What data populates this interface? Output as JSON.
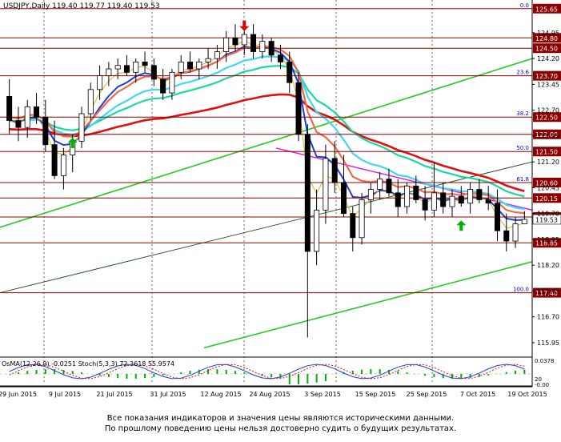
{
  "header": {
    "title": "USDJPY,Daily  119.40 119.77 119.40 119.53"
  },
  "oscillator": {
    "label": "OsMA(12,26,9) -0.0251  Stoch(5,3,3) 72.3618 55.9574",
    "scale_top": "0.0378",
    "scale_mid": "20",
    "scale_bot": "-0.00"
  },
  "disclaimer": {
    "line1": "Все показания индикаторов и значения цены являются историческими данными.",
    "line2": "По прошлому поведению цены нельзя достоверно судить о будущих результатах."
  },
  "colors": {
    "background": "#ffffff",
    "axis": "#000000",
    "candle": "#000000",
    "level_line": "#8b0000",
    "fib_text": "#0000cd",
    "right_label_bg": "#8b0000",
    "up_arrow": "#00b000",
    "down_arrow": "#e00000",
    "ema_blue": "#1c3fd8",
    "ema_cyan": "#3fd8f0",
    "ema_teal": "#1ed6a0",
    "ema_red": "#e01010",
    "ema_orange": "#f06a4a",
    "ema_yellow": "#e0b020",
    "trend_green": "#22cc22",
    "trend_magenta": "#e020e0"
  },
  "chart_data": {
    "type": "candlestick",
    "symbol": "USDJPY",
    "timeframe": "Daily",
    "ohlc_header": {
      "open": 119.4,
      "high": 119.77,
      "low": 119.4,
      "close": 119.53
    },
    "ylim": [
      115.6,
      125.9
    ],
    "y_ticks": [
      "124.95",
      "124.20",
      "123.45",
      "122.70",
      "121.95",
      "121.20",
      "120.45",
      "119.70",
      "118.95",
      "118.20",
      "117.45",
      "116.70",
      "115.95"
    ],
    "x_ticks": [
      "29 Jun 2015",
      "9 Jul 2015",
      "21 Jul 2015",
      "31 Jul 2015",
      "12 Aug 2015",
      "24 Aug 2015",
      "3 Sep 2015",
      "15 Sep 2015",
      "25 Sep 2015",
      "7 Oct 2015",
      "19 Oct 2015"
    ],
    "horizontal_levels": [
      {
        "price": 125.65,
        "label": "125.65",
        "fib": "0.0"
      },
      {
        "price": 124.8,
        "label": "124.80",
        "fib": ""
      },
      {
        "price": 124.5,
        "label": "124.50",
        "fib": ""
      },
      {
        "price": 123.7,
        "label": "123.70",
        "fib": "23.6"
      },
      {
        "price": 122.5,
        "label": "122.50",
        "fib": "38.2"
      },
      {
        "price": 122.0,
        "label": "122.00",
        "fib": ""
      },
      {
        "price": 121.5,
        "label": "121.50",
        "fib": "50.0"
      },
      {
        "price": 120.6,
        "label": "120.60",
        "fib": "61.8"
      },
      {
        "price": 120.15,
        "label": "120.15",
        "fib": ""
      },
      {
        "price": 119.6,
        "label": "119.60",
        "fib": ""
      },
      {
        "price": 118.85,
        "label": "118.85",
        "fib": ""
      },
      {
        "price": 117.4,
        "label": "117.40",
        "fib": "100.0"
      }
    ],
    "current_price": {
      "value": 119.53,
      "label": "119.53"
    },
    "candles": [
      {
        "o": 123.1,
        "h": 123.6,
        "l": 122.0,
        "c": 122.4
      },
      {
        "o": 122.4,
        "h": 122.8,
        "l": 121.8,
        "c": 122.2
      },
      {
        "o": 122.2,
        "h": 123.0,
        "l": 121.9,
        "c": 122.8
      },
      {
        "o": 122.8,
        "h": 123.2,
        "l": 122.3,
        "c": 122.5
      },
      {
        "o": 122.5,
        "h": 123.0,
        "l": 121.5,
        "c": 121.7
      },
      {
        "o": 121.7,
        "h": 122.4,
        "l": 120.7,
        "c": 120.8
      },
      {
        "o": 120.8,
        "h": 121.6,
        "l": 120.4,
        "c": 121.4
      },
      {
        "o": 121.4,
        "h": 122.0,
        "l": 120.9,
        "c": 121.8
      },
      {
        "o": 121.8,
        "h": 122.8,
        "l": 121.6,
        "c": 122.6
      },
      {
        "o": 122.6,
        "h": 123.5,
        "l": 122.4,
        "c": 123.3
      },
      {
        "o": 123.3,
        "h": 124.0,
        "l": 123.0,
        "c": 123.7
      },
      {
        "o": 123.7,
        "h": 124.1,
        "l": 123.4,
        "c": 123.9
      },
      {
        "o": 123.9,
        "h": 124.2,
        "l": 123.6,
        "c": 124.0
      },
      {
        "o": 124.0,
        "h": 124.3,
        "l": 123.7,
        "c": 123.8
      },
      {
        "o": 123.8,
        "h": 124.2,
        "l": 123.5,
        "c": 124.1
      },
      {
        "o": 124.1,
        "h": 124.4,
        "l": 123.8,
        "c": 124.0
      },
      {
        "o": 124.0,
        "h": 124.2,
        "l": 123.4,
        "c": 123.6
      },
      {
        "o": 123.6,
        "h": 123.9,
        "l": 123.0,
        "c": 123.2
      },
      {
        "o": 123.2,
        "h": 123.9,
        "l": 123.0,
        "c": 123.8
      },
      {
        "o": 123.8,
        "h": 124.3,
        "l": 123.6,
        "c": 124.1
      },
      {
        "o": 124.1,
        "h": 124.4,
        "l": 123.8,
        "c": 123.9
      },
      {
        "o": 123.9,
        "h": 124.2,
        "l": 123.6,
        "c": 124.1
      },
      {
        "o": 124.1,
        "h": 124.5,
        "l": 123.9,
        "c": 124.2
      },
      {
        "o": 124.2,
        "h": 124.6,
        "l": 123.9,
        "c": 124.4
      },
      {
        "o": 124.4,
        "h": 125.0,
        "l": 124.1,
        "c": 124.8
      },
      {
        "o": 124.8,
        "h": 125.2,
        "l": 124.4,
        "c": 124.6
      },
      {
        "o": 124.6,
        "h": 125.3,
        "l": 124.3,
        "c": 124.9
      },
      {
        "o": 124.9,
        "h": 125.2,
        "l": 124.2,
        "c": 124.4
      },
      {
        "o": 124.4,
        "h": 124.9,
        "l": 124.2,
        "c": 124.7
      },
      {
        "o": 124.7,
        "h": 124.8,
        "l": 124.1,
        "c": 124.3
      },
      {
        "o": 124.3,
        "h": 124.6,
        "l": 123.9,
        "c": 124.1
      },
      {
        "o": 124.1,
        "h": 124.4,
        "l": 123.2,
        "c": 123.5
      },
      {
        "o": 123.5,
        "h": 123.8,
        "l": 121.8,
        "c": 122.0
      },
      {
        "o": 122.0,
        "h": 122.3,
        "l": 116.1,
        "c": 118.6
      },
      {
        "o": 118.6,
        "h": 120.4,
        "l": 118.2,
        "c": 119.8
      },
      {
        "o": 119.8,
        "h": 121.7,
        "l": 119.4,
        "c": 121.3
      },
      {
        "o": 121.3,
        "h": 121.8,
        "l": 120.3,
        "c": 120.6
      },
      {
        "o": 120.6,
        "h": 121.4,
        "l": 119.6,
        "c": 119.7
      },
      {
        "o": 119.7,
        "h": 119.9,
        "l": 118.6,
        "c": 119.0
      },
      {
        "o": 119.0,
        "h": 120.3,
        "l": 118.8,
        "c": 120.1
      },
      {
        "o": 120.1,
        "h": 120.6,
        "l": 119.7,
        "c": 120.4
      },
      {
        "o": 120.4,
        "h": 120.9,
        "l": 120.1,
        "c": 120.7
      },
      {
        "o": 120.7,
        "h": 121.0,
        "l": 120.2,
        "c": 120.3
      },
      {
        "o": 120.3,
        "h": 120.7,
        "l": 119.6,
        "c": 119.9
      },
      {
        "o": 119.9,
        "h": 120.6,
        "l": 119.7,
        "c": 120.5
      },
      {
        "o": 120.5,
        "h": 120.8,
        "l": 120.0,
        "c": 120.1
      },
      {
        "o": 120.1,
        "h": 120.5,
        "l": 119.5,
        "c": 119.8
      },
      {
        "o": 119.8,
        "h": 121.2,
        "l": 119.6,
        "c": 120.3
      },
      {
        "o": 120.3,
        "h": 120.6,
        "l": 119.7,
        "c": 119.9
      },
      {
        "o": 119.9,
        "h": 120.4,
        "l": 119.6,
        "c": 120.2
      },
      {
        "o": 120.2,
        "h": 120.5,
        "l": 119.9,
        "c": 120.0
      },
      {
        "o": 120.0,
        "h": 120.6,
        "l": 119.7,
        "c": 120.4
      },
      {
        "o": 120.4,
        "h": 120.7,
        "l": 120.0,
        "c": 120.1
      },
      {
        "o": 120.1,
        "h": 120.5,
        "l": 119.8,
        "c": 120.0
      },
      {
        "o": 120.0,
        "h": 120.4,
        "l": 118.9,
        "c": 119.2
      },
      {
        "o": 119.2,
        "h": 119.7,
        "l": 118.6,
        "c": 118.9
      },
      {
        "o": 118.9,
        "h": 119.6,
        "l": 118.7,
        "c": 119.4
      },
      {
        "o": 119.4,
        "h": 119.77,
        "l": 119.4,
        "c": 119.53
      }
    ]
  }
}
